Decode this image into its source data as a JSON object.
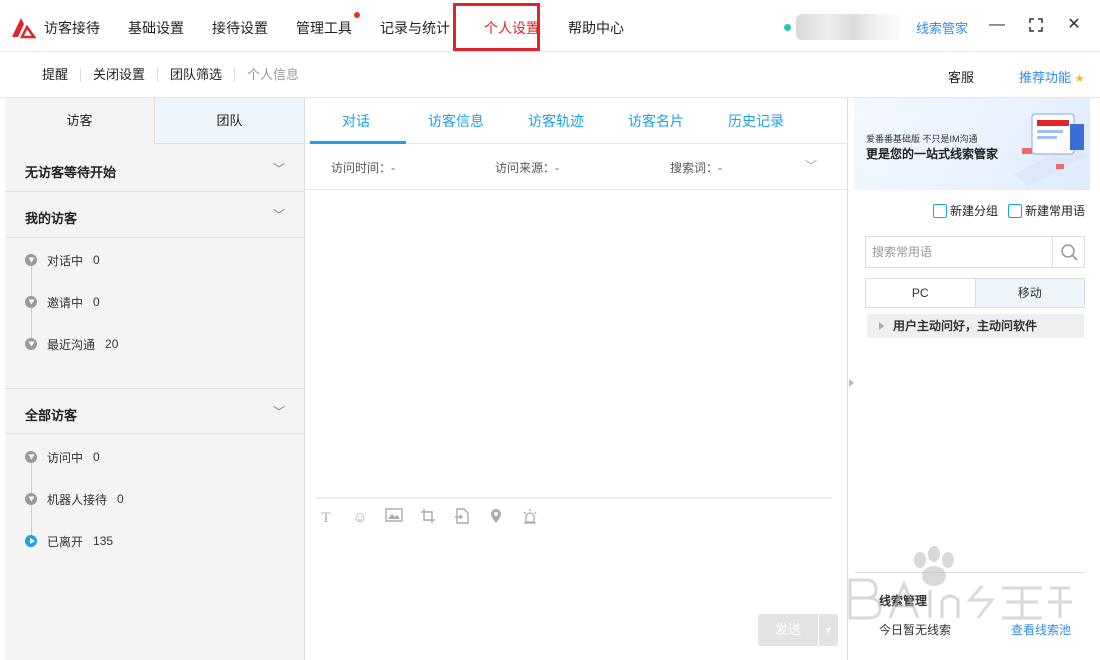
{
  "topbar": {
    "nav": [
      {
        "label": "访客接待"
      },
      {
        "label": "基础设置"
      },
      {
        "label": "接待设置"
      },
      {
        "label": "管理工具"
      },
      {
        "label": "记录与统计"
      },
      {
        "label": "个人设置"
      },
      {
        "label": "帮助中心"
      }
    ],
    "active_label": "个人设置",
    "lead_manager": "线索管家",
    "colors": {
      "accent": "#e0252a",
      "link": "#2d8cf0",
      "online": "#25c6b5"
    }
  },
  "subbar": {
    "items": [
      "提醒",
      "关闭设置",
      "团队筛选",
      "个人信息"
    ],
    "service": "客服",
    "recommend": "推荐功能"
  },
  "left": {
    "tabs": [
      "访客",
      "团队"
    ],
    "no_visitor": "无访客等待开始",
    "my_visitors": {
      "title": "我的访客",
      "rows": [
        {
          "label": "对话中",
          "count": "0"
        },
        {
          "label": "邀请中",
          "count": "0"
        },
        {
          "label": "最近沟通",
          "count": "20"
        }
      ]
    },
    "all_visitors": {
      "title": "全部访客",
      "rows": [
        {
          "label": "访问中",
          "count": "0"
        },
        {
          "label": "机器人接待",
          "count": "0"
        },
        {
          "label": "已离开",
          "count": "135"
        }
      ]
    }
  },
  "center": {
    "tabs": [
      "对话",
      "访客信息",
      "访客轨迹",
      "访客名片",
      "历史记录"
    ],
    "info": {
      "visit_time": "访问时间：-",
      "visit_source": "访问来源：-",
      "search_word": "搜索词：-"
    },
    "send": "发送"
  },
  "right": {
    "banner": {
      "line1": "爱番番基础版 不只是IM沟通",
      "line2": "更是您的一站式线索管家"
    },
    "new_group": "新建分组",
    "new_phrase": "新建常用语",
    "search_placeholder": "搜索常用语",
    "device_tabs": [
      "PC",
      "移动"
    ],
    "phrase_group": "用户主动问好，主动问软件",
    "lead_title": "线索管理",
    "lead_none": "今日暂无线索",
    "lead_pool": "查看线索池"
  }
}
